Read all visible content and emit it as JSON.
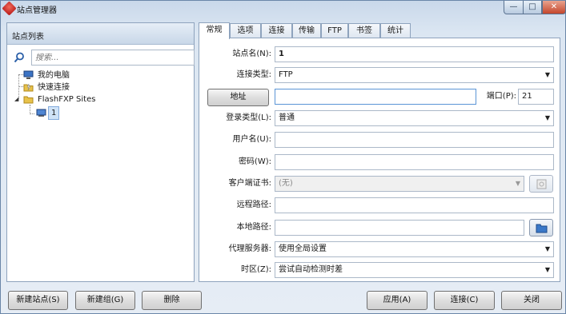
{
  "window": {
    "title": "站点管理器",
    "minimize": "—",
    "maximize": "□",
    "close": "✕"
  },
  "site_list": {
    "header": "站点列表",
    "search_placeholder": "搜索...",
    "tree": [
      {
        "label": "我的电脑",
        "icon": "computer-icon"
      },
      {
        "label": "快速连接",
        "icon": "quick-connect-folder-icon"
      },
      {
        "label": "FlashFXP Sites",
        "icon": "folder-icon"
      },
      {
        "label": "1",
        "icon": "site-icon"
      }
    ]
  },
  "tabs": [
    "常规",
    "选项",
    "连接",
    "传输",
    "FTP",
    "书签",
    "统计"
  ],
  "form": {
    "site_name": {
      "label": "站点名(N):",
      "value": "1"
    },
    "connection_type": {
      "label": "连接类型:",
      "value": "FTP"
    },
    "address": {
      "button": "地址",
      "value": ""
    },
    "port": {
      "label": "端口(P):",
      "value": "21"
    },
    "login_type": {
      "label": "登录类型(L):",
      "value": "普通"
    },
    "username": {
      "label": "用户名(U):",
      "value": ""
    },
    "password": {
      "label": "密码(W):",
      "value": ""
    },
    "client_cert": {
      "label": "客户端证书:",
      "value": "(无)"
    },
    "remote_path": {
      "label": "远程路径:",
      "value": ""
    },
    "local_path": {
      "label": "本地路径:",
      "value": ""
    },
    "proxy": {
      "label": "代理服务器:",
      "value": "使用全局设置"
    },
    "timezone": {
      "label": "时区(Z):",
      "value": "尝试自动检测时差"
    }
  },
  "bottom": {
    "new_site": "新建站点(S)",
    "new_group": "新建组(G)",
    "delete": "删除",
    "apply": "应用(A)",
    "connect": "连接(C)",
    "close": "关闭"
  }
}
